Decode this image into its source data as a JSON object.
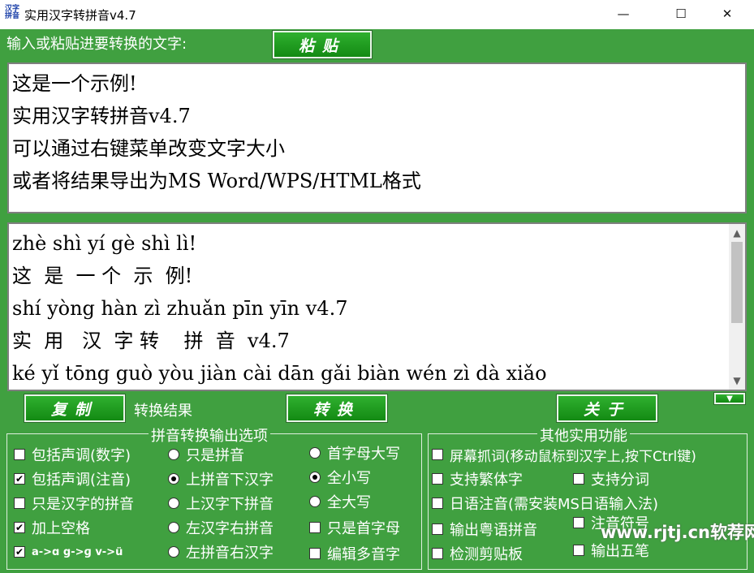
{
  "window": {
    "title": "实用汉字转拼音v4.7",
    "icon_text": "汉字拼音",
    "minimize_glyph": "—",
    "maximize_glyph": "☐",
    "close_glyph": "✕"
  },
  "input_section": {
    "label": "输入或粘贴进要转换的文字:",
    "paste_button": "粘贴",
    "lines": [
      "这是一个示例!",
      "实用汉字转拼音v4.7",
      "可以通过右键菜单改变文字大小",
      "或者将结果导出为MS Word/WPS/HTML格式"
    ]
  },
  "output_section": {
    "lines": [
      "zhè shì yí gè shì lì!",
      "这  是  一 个  示  例!",
      "shí yòng hàn zì zhuǎn pīn yīn v4.7",
      "实  用   汉  字 转    拼  音  v4.7",
      "ké yǐ tōng guò yòu jiàn cài dān gǎi biàn wén zì dà xiǎo"
    ],
    "scroll_up": "▲",
    "scroll_down": "▼"
  },
  "action_bar": {
    "copy_button": "复制",
    "result_label": "转换结果",
    "convert_button": "转换",
    "about_button": "关于",
    "collapse_glyph": "▼"
  },
  "pinyin_options": {
    "title": "拼音转换输出选项",
    "col1": [
      {
        "label": "包括声调(数字)",
        "checked": false
      },
      {
        "label": "包括声调(注音)",
        "checked": true
      },
      {
        "label": "只是汉字的拼音",
        "checked": false
      },
      {
        "label": "加上空格",
        "checked": true
      },
      {
        "label": "a->ɑ g->ɡ v->ü",
        "checked": true
      }
    ],
    "col2": [
      {
        "label": "只是拼音",
        "selected": false
      },
      {
        "label": "上拼音下汉字",
        "selected": true
      },
      {
        "label": "上汉字下拼音",
        "selected": false
      },
      {
        "label": "左汉字右拼音",
        "selected": false
      },
      {
        "label": "左拼音右汉字",
        "selected": false
      }
    ],
    "col3_radios": [
      {
        "label": "首字母大写",
        "selected": false
      },
      {
        "label": "全小写",
        "selected": true
      },
      {
        "label": "全大写",
        "selected": false
      }
    ],
    "col3_checks": [
      {
        "label": "只是首字母",
        "checked": false
      },
      {
        "label": "编辑多音字",
        "checked": false
      }
    ]
  },
  "other_functions": {
    "title": "其他实用功能",
    "screen_grab": "屏幕抓词(移动鼠标到汉字上,按下Ctrl键)",
    "traditional": "支持繁体字",
    "segment": "支持分词",
    "japanese": "日语注音(需安装MS日语输入法)",
    "cantonese": "输出粤语拼音",
    "zhuyin": "注音符号",
    "clipboard": "检测剪贴板",
    "wubi": "输出五笔"
  },
  "watermark": {
    "text": "www.rjtj.cn软荐网"
  }
}
